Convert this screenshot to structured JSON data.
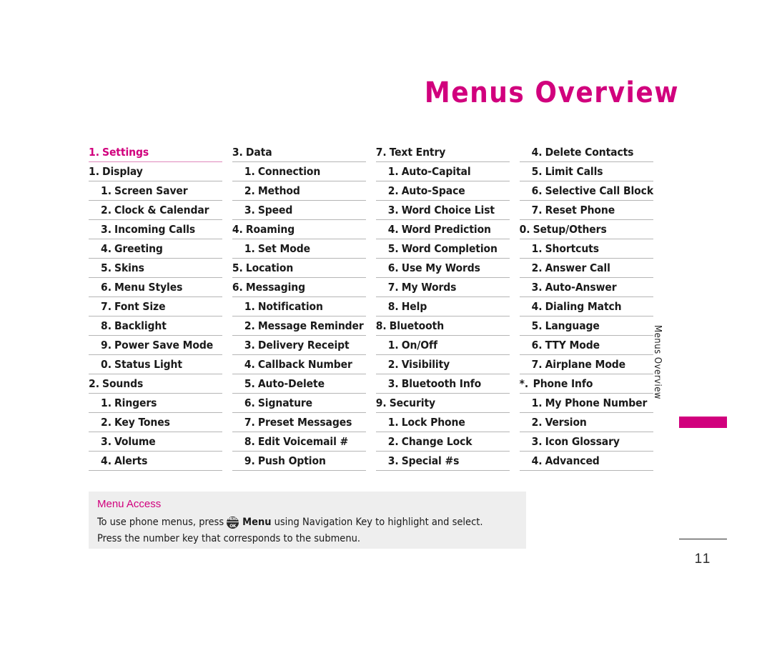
{
  "page": {
    "title": "Menus Overview",
    "side_tab_label": "Menus Overview",
    "page_number": "11"
  },
  "menu_columns": [
    {
      "id": "column-1",
      "rows": [
        {
          "num": "1.",
          "label": "Settings",
          "level": 1,
          "accent": true
        },
        {
          "num": "1.",
          "label": "Display",
          "level": 1,
          "accent": false
        },
        {
          "num": "1.",
          "label": "Screen Saver",
          "level": 2,
          "accent": false
        },
        {
          "num": "2.",
          "label": "Clock & Calendar",
          "level": 2,
          "accent": false
        },
        {
          "num": "3.",
          "label": "Incoming Calls",
          "level": 2,
          "accent": false
        },
        {
          "num": "4.",
          "label": "Greeting",
          "level": 2,
          "accent": false
        },
        {
          "num": "5.",
          "label": "Skins",
          "level": 2,
          "accent": false
        },
        {
          "num": "6.",
          "label": "Menu Styles",
          "level": 2,
          "accent": false
        },
        {
          "num": "7.",
          "label": "Font Size",
          "level": 2,
          "accent": false
        },
        {
          "num": "8.",
          "label": "Backlight",
          "level": 2,
          "accent": false
        },
        {
          "num": "9.",
          "label": "Power Save Mode",
          "level": 2,
          "accent": false
        },
        {
          "num": "0.",
          "label": "Status Light",
          "level": 2,
          "accent": false
        },
        {
          "num": "2.",
          "label": "Sounds",
          "level": 1,
          "accent": false
        },
        {
          "num": "1.",
          "label": "Ringers",
          "level": 2,
          "accent": false
        },
        {
          "num": "2.",
          "label": "Key Tones",
          "level": 2,
          "accent": false
        },
        {
          "num": "3.",
          "label": "Volume",
          "level": 2,
          "accent": false
        },
        {
          "num": "4.",
          "label": "Alerts",
          "level": 2,
          "accent": false
        }
      ]
    },
    {
      "id": "column-2",
      "rows": [
        {
          "num": "3.",
          "label": "Data",
          "level": 1,
          "accent": false
        },
        {
          "num": "1.",
          "label": "Connection",
          "level": 2,
          "accent": false
        },
        {
          "num": "2.",
          "label": "Method",
          "level": 2,
          "accent": false
        },
        {
          "num": "3.",
          "label": "Speed",
          "level": 2,
          "accent": false
        },
        {
          "num": "4.",
          "label": "Roaming",
          "level": 1,
          "accent": false
        },
        {
          "num": "1.",
          "label": "Set Mode",
          "level": 2,
          "accent": false
        },
        {
          "num": "5.",
          "label": "Location",
          "level": 1,
          "accent": false
        },
        {
          "num": "6.",
          "label": "Messaging",
          "level": 1,
          "accent": false
        },
        {
          "num": "1.",
          "label": "Notification",
          "level": 2,
          "accent": false
        },
        {
          "num": "2.",
          "label": "Message Reminder",
          "level": 2,
          "accent": false
        },
        {
          "num": "3.",
          "label": "Delivery Receipt",
          "level": 2,
          "accent": false
        },
        {
          "num": "4.",
          "label": "Callback Number",
          "level": 2,
          "accent": false
        },
        {
          "num": "5.",
          "label": "Auto-Delete",
          "level": 2,
          "accent": false
        },
        {
          "num": "6.",
          "label": "Signature",
          "level": 2,
          "accent": false
        },
        {
          "num": "7.",
          "label": "Preset Messages",
          "level": 2,
          "accent": false
        },
        {
          "num": "8.",
          "label": "Edit Voicemail #",
          "level": 2,
          "accent": false
        },
        {
          "num": "9.",
          "label": "Push Option",
          "level": 2,
          "accent": false
        }
      ]
    },
    {
      "id": "column-3",
      "rows": [
        {
          "num": "7.",
          "label": "Text Entry",
          "level": 1,
          "accent": false
        },
        {
          "num": "1.",
          "label": "Auto-Capital",
          "level": 2,
          "accent": false
        },
        {
          "num": "2.",
          "label": "Auto-Space",
          "level": 2,
          "accent": false
        },
        {
          "num": "3.",
          "label": "Word Choice List",
          "level": 2,
          "accent": false
        },
        {
          "num": "4.",
          "label": "Word Prediction",
          "level": 2,
          "accent": false
        },
        {
          "num": "5.",
          "label": "Word Completion",
          "level": 2,
          "accent": false
        },
        {
          "num": "6.",
          "label": "Use My Words",
          "level": 2,
          "accent": false
        },
        {
          "num": "7.",
          "label": "My Words",
          "level": 2,
          "accent": false
        },
        {
          "num": "8.",
          "label": "Help",
          "level": 2,
          "accent": false
        },
        {
          "num": "8.",
          "label": "Bluetooth",
          "level": 1,
          "accent": false
        },
        {
          "num": "1.",
          "label": "On/Off",
          "level": 2,
          "accent": false
        },
        {
          "num": "2.",
          "label": "Visibility",
          "level": 2,
          "accent": false
        },
        {
          "num": "3.",
          "label": "Bluetooth Info",
          "level": 2,
          "accent": false
        },
        {
          "num": "9.",
          "label": "Security",
          "level": 1,
          "accent": false
        },
        {
          "num": "1.",
          "label": "Lock Phone",
          "level": 2,
          "accent": false
        },
        {
          "num": "2.",
          "label": "Change Lock",
          "level": 2,
          "accent": false
        },
        {
          "num": "3.",
          "label": "Special #s",
          "level": 2,
          "accent": false
        }
      ]
    },
    {
      "id": "column-4",
      "rows": [
        {
          "num": "4.",
          "label": "Delete Contacts",
          "level": 2,
          "accent": false
        },
        {
          "num": "5.",
          "label": "Limit Calls",
          "level": 2,
          "accent": false
        },
        {
          "num": "6.",
          "label": "Selective Call Block",
          "level": 2,
          "accent": false
        },
        {
          "num": "7.",
          "label": "Reset Phone",
          "level": 2,
          "accent": false
        },
        {
          "num": "0.",
          "label": "Setup/Others",
          "level": 1,
          "accent": false
        },
        {
          "num": "1.",
          "label": "Shortcuts",
          "level": 2,
          "accent": false
        },
        {
          "num": "2.",
          "label": "Answer Call",
          "level": 2,
          "accent": false
        },
        {
          "num": "3.",
          "label": "Auto-Answer",
          "level": 2,
          "accent": false
        },
        {
          "num": "4.",
          "label": "Dialing Match",
          "level": 2,
          "accent": false
        },
        {
          "num": "5.",
          "label": "Language",
          "level": 2,
          "accent": false
        },
        {
          "num": "6.",
          "label": "TTY Mode",
          "level": 2,
          "accent": false
        },
        {
          "num": "7.",
          "label": "Airplane Mode",
          "level": 2,
          "accent": false
        },
        {
          "num": "*.",
          "label": "Phone Info",
          "level": 1,
          "accent": false
        },
        {
          "num": "1.",
          "label": "My Phone Number",
          "level": 2,
          "accent": false
        },
        {
          "num": "2.",
          "label": "Version",
          "level": 2,
          "accent": false
        },
        {
          "num": "3.",
          "label": "Icon Glossary",
          "level": 2,
          "accent": false
        },
        {
          "num": "4.",
          "label": "Advanced",
          "level": 2,
          "accent": false
        }
      ]
    }
  ],
  "menu_access": {
    "title": "Menu Access",
    "line1_before_key": "To use phone menus, press",
    "key_icon_top": "MENU",
    "key_icon_bottom": "OK",
    "line1_strong": "Menu",
    "line1_after_key": "using Navigation Key to highlight and select.",
    "line2": "Press the number key that corresponds to the submenu."
  }
}
